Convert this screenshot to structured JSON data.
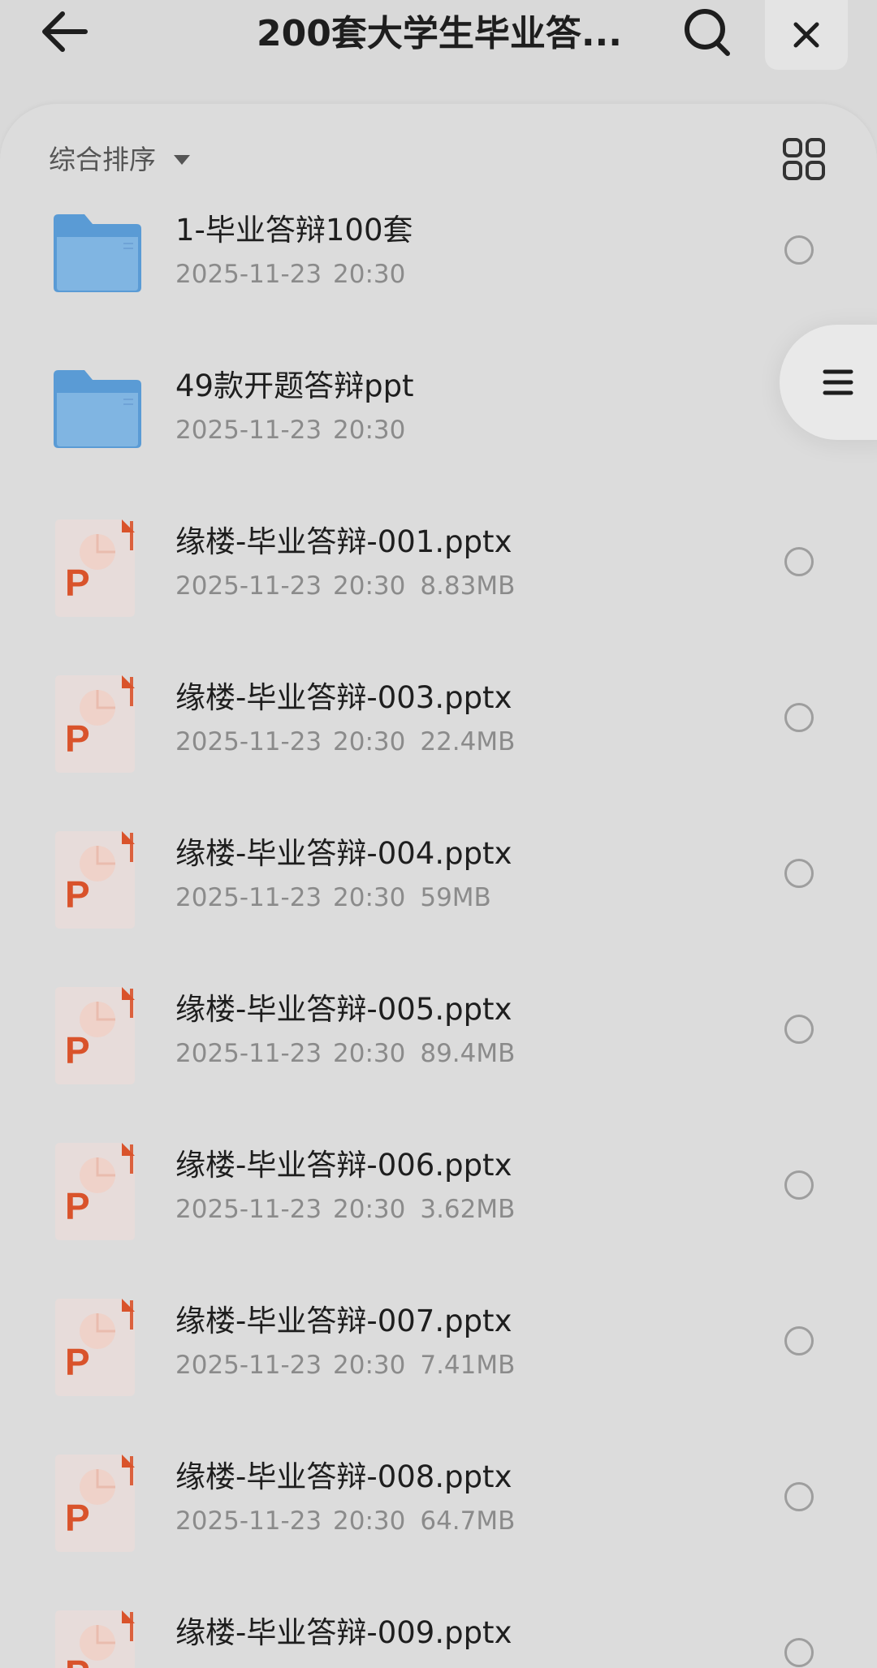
{
  "header": {
    "title": "200套大学生毕业答...",
    "back_icon": "arrow-left-icon",
    "search_icon": "search-icon",
    "close_icon": "close-icon"
  },
  "toolbar": {
    "sort_label": "综合排序",
    "grid_icon": "grid-view-icon"
  },
  "float_menu": {
    "icon": "menu-icon"
  },
  "files": [
    {
      "type": "folder",
      "name": "1-毕业答辩100套",
      "date": "2025-11-23 20:30",
      "size": ""
    },
    {
      "type": "folder",
      "name": "49款开题答辩ppt",
      "date": "2025-11-23 20:30",
      "size": ""
    },
    {
      "type": "pptx",
      "name": "缘楼-毕业答辩-001.pptx",
      "date": "2025-11-23 20:30",
      "size": "8.83MB"
    },
    {
      "type": "pptx",
      "name": "缘楼-毕业答辩-003.pptx",
      "date": "2025-11-23 20:30",
      "size": "22.4MB"
    },
    {
      "type": "pptx",
      "name": "缘楼-毕业答辩-004.pptx",
      "date": "2025-11-23 20:30",
      "size": "59MB"
    },
    {
      "type": "pptx",
      "name": "缘楼-毕业答辩-005.pptx",
      "date": "2025-11-23 20:30",
      "size": "89.4MB"
    },
    {
      "type": "pptx",
      "name": "缘楼-毕业答辩-006.pptx",
      "date": "2025-11-23 20:30",
      "size": "3.62MB"
    },
    {
      "type": "pptx",
      "name": "缘楼-毕业答辩-007.pptx",
      "date": "2025-11-23 20:30",
      "size": "7.41MB"
    },
    {
      "type": "pptx",
      "name": "缘楼-毕业答辩-008.pptx",
      "date": "2025-11-23 20:30",
      "size": "64.7MB"
    },
    {
      "type": "pptx",
      "name": "缘楼-毕业答辩-009.pptx",
      "date": "",
      "size": ""
    }
  ],
  "colors": {
    "folder": "#5a9bd5",
    "ppt_accent": "#d9532b",
    "background": "#d9d9d9"
  }
}
